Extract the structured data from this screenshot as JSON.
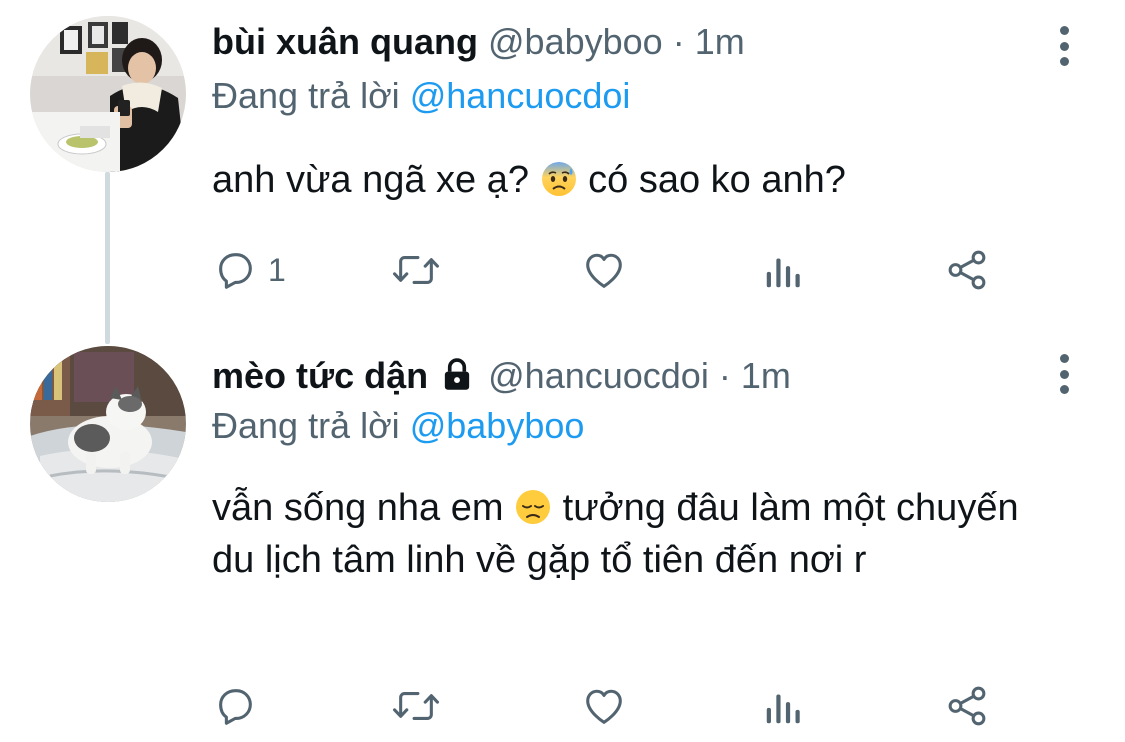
{
  "tweets": [
    {
      "name": "bùi xuân quang",
      "handle": "@babyboo",
      "dot": "·",
      "time": "1m",
      "replying_prefix": "Đang trả lời",
      "replying_to": "@hancuocdoi",
      "text_before_emoji": "anh vừa ngã xe ạ?",
      "emoji": "anxious-face-with-sweat",
      "text_after_emoji": "có sao ko anh?",
      "reply_count": "1",
      "locked": false
    },
    {
      "name": "mèo tức dận",
      "handle": "@hancuocdoi",
      "dot": "·",
      "time": "1m",
      "replying_prefix": "Đang trả lời",
      "replying_to": "@babyboo",
      "text_before_emoji": "vẫn sống nha em",
      "emoji": "disappointed-face",
      "text_after_emoji": "tưởng đâu làm một chuyến du lịch tâm linh về gặp tổ tiên đến nơi r",
      "reply_count": "",
      "locked": true
    }
  ],
  "colors": {
    "text": "#0f1419",
    "secondary": "#536471",
    "link": "#1d9bf0",
    "thread_line": "#cfd9de"
  },
  "icons": [
    "reply-icon",
    "retweet-icon",
    "like-icon",
    "views-icon",
    "share-icon",
    "more-icon",
    "lock-icon"
  ]
}
